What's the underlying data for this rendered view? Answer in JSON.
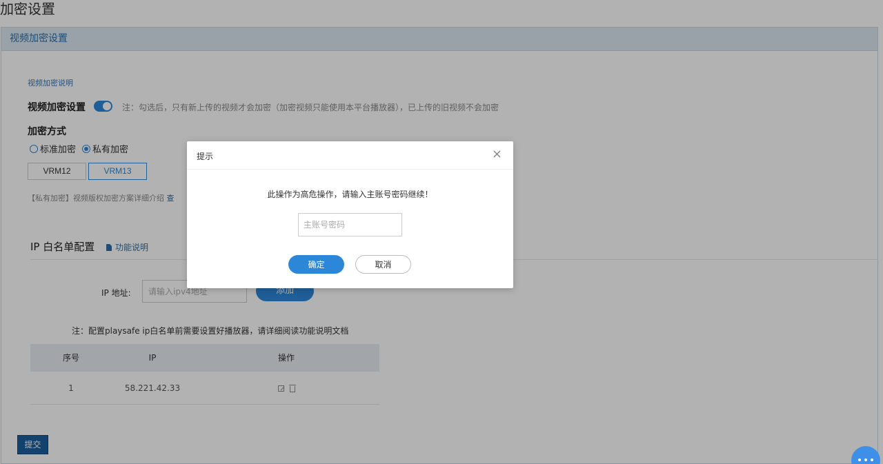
{
  "page": {
    "title": "加密设置"
  },
  "panel": {
    "header": "视频加密设置",
    "explain_link": "视频加密说明",
    "encrypt_setting_label": "视频加密设置",
    "toggle_on": true,
    "encrypt_note": "注：勾选后，只有新上传的视频才会加密（加密视频只能使用本平台播放器），已上传的旧视频不会加密",
    "method_label": "加密方式",
    "methods": [
      {
        "label": "标准加密",
        "checked": false
      },
      {
        "label": "私有加密",
        "checked": true
      }
    ],
    "versions": [
      {
        "label": "VRM12",
        "active": false
      },
      {
        "label": "VRM13",
        "active": true
      }
    ],
    "private_note": "【私有加密】视频版权加密方案详细介绍",
    "private_link_partial": "查"
  },
  "ip_whitelist": {
    "title": "IP 白名单配置",
    "feature_link": "功能说明",
    "ip_label": "IP 地址:",
    "ip_placeholder": "请输入ipv4地址",
    "add_label": "添加",
    "note": "注：配置playsafe ip白名单前需要设置好播放器，请详细阅读功能说明文档",
    "table": {
      "headers": [
        "序号",
        "IP",
        "操作"
      ],
      "rows": [
        {
          "index": "1",
          "ip": "58.221.42.33"
        }
      ]
    }
  },
  "submit_label": "提交",
  "modal": {
    "title": "提示",
    "close_glyph": "×",
    "message": "此操作为高危操作，请输入主账号密码继续！",
    "password_placeholder": "主账号密码",
    "ok_label": "确定",
    "cancel_label": "取消"
  },
  "colors": {
    "accent": "#2d87d8",
    "panel_header_bg": "#dce9f3",
    "submit_bg": "#1b5f9c"
  }
}
